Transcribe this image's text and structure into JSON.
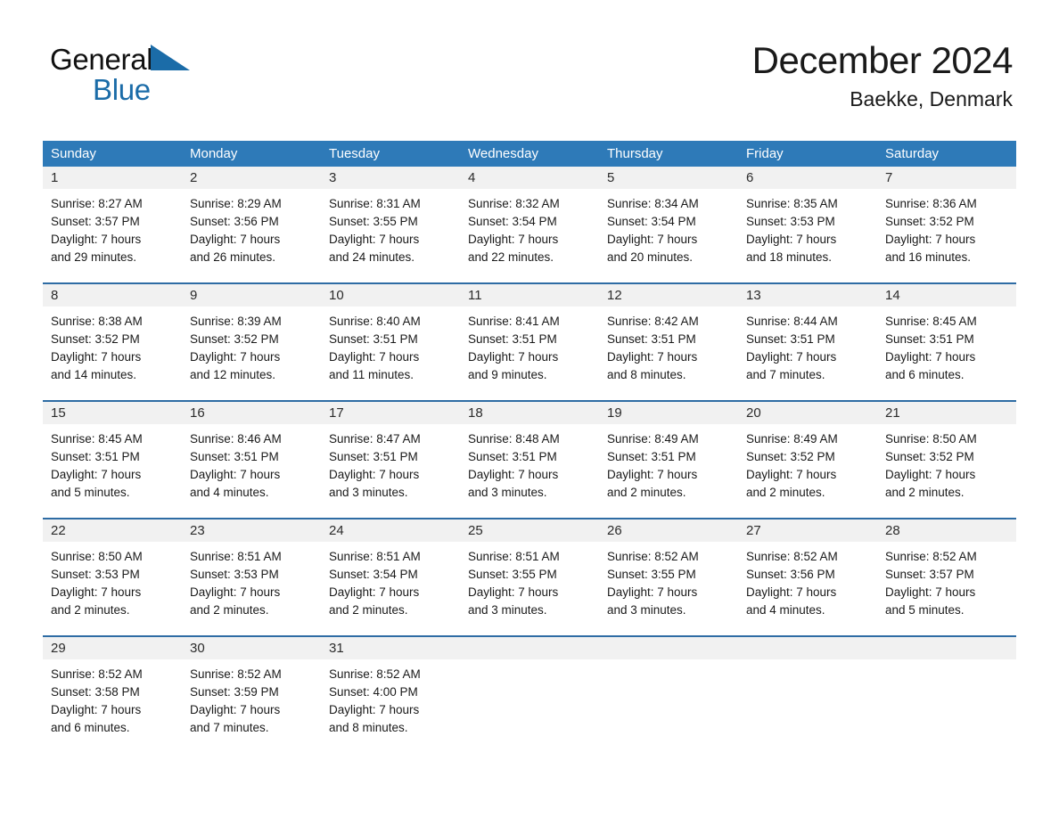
{
  "brand": {
    "name_part1": "General",
    "name_part2": "Blue",
    "triangle_color": "#1b6ca8"
  },
  "header": {
    "month_title": "December 2024",
    "location": "Baekke, Denmark"
  },
  "colors": {
    "header_blue": "#2e7ab8",
    "row_divider_blue": "#2e6ca4",
    "daynum_band_gray": "#f1f1f1",
    "page_background": "#ffffff"
  },
  "weekdays": [
    "Sunday",
    "Monday",
    "Tuesday",
    "Wednesday",
    "Thursday",
    "Friday",
    "Saturday"
  ],
  "weeks": [
    {
      "days": [
        {
          "num": "1",
          "sunrise": "Sunrise: 8:27 AM",
          "sunset": "Sunset: 3:57 PM",
          "daylight1": "Daylight: 7 hours",
          "daylight2": "and 29 minutes."
        },
        {
          "num": "2",
          "sunrise": "Sunrise: 8:29 AM",
          "sunset": "Sunset: 3:56 PM",
          "daylight1": "Daylight: 7 hours",
          "daylight2": "and 26 minutes."
        },
        {
          "num": "3",
          "sunrise": "Sunrise: 8:31 AM",
          "sunset": "Sunset: 3:55 PM",
          "daylight1": "Daylight: 7 hours",
          "daylight2": "and 24 minutes."
        },
        {
          "num": "4",
          "sunrise": "Sunrise: 8:32 AM",
          "sunset": "Sunset: 3:54 PM",
          "daylight1": "Daylight: 7 hours",
          "daylight2": "and 22 minutes."
        },
        {
          "num": "5",
          "sunrise": "Sunrise: 8:34 AM",
          "sunset": "Sunset: 3:54 PM",
          "daylight1": "Daylight: 7 hours",
          "daylight2": "and 20 minutes."
        },
        {
          "num": "6",
          "sunrise": "Sunrise: 8:35 AM",
          "sunset": "Sunset: 3:53 PM",
          "daylight1": "Daylight: 7 hours",
          "daylight2": "and 18 minutes."
        },
        {
          "num": "7",
          "sunrise": "Sunrise: 8:36 AM",
          "sunset": "Sunset: 3:52 PM",
          "daylight1": "Daylight: 7 hours",
          "daylight2": "and 16 minutes."
        }
      ]
    },
    {
      "days": [
        {
          "num": "8",
          "sunrise": "Sunrise: 8:38 AM",
          "sunset": "Sunset: 3:52 PM",
          "daylight1": "Daylight: 7 hours",
          "daylight2": "and 14 minutes."
        },
        {
          "num": "9",
          "sunrise": "Sunrise: 8:39 AM",
          "sunset": "Sunset: 3:52 PM",
          "daylight1": "Daylight: 7 hours",
          "daylight2": "and 12 minutes."
        },
        {
          "num": "10",
          "sunrise": "Sunrise: 8:40 AM",
          "sunset": "Sunset: 3:51 PM",
          "daylight1": "Daylight: 7 hours",
          "daylight2": "and 11 minutes."
        },
        {
          "num": "11",
          "sunrise": "Sunrise: 8:41 AM",
          "sunset": "Sunset: 3:51 PM",
          "daylight1": "Daylight: 7 hours",
          "daylight2": "and 9 minutes."
        },
        {
          "num": "12",
          "sunrise": "Sunrise: 8:42 AM",
          "sunset": "Sunset: 3:51 PM",
          "daylight1": "Daylight: 7 hours",
          "daylight2": "and 8 minutes."
        },
        {
          "num": "13",
          "sunrise": "Sunrise: 8:44 AM",
          "sunset": "Sunset: 3:51 PM",
          "daylight1": "Daylight: 7 hours",
          "daylight2": "and 7 minutes."
        },
        {
          "num": "14",
          "sunrise": "Sunrise: 8:45 AM",
          "sunset": "Sunset: 3:51 PM",
          "daylight1": "Daylight: 7 hours",
          "daylight2": "and 6 minutes."
        }
      ]
    },
    {
      "days": [
        {
          "num": "15",
          "sunrise": "Sunrise: 8:45 AM",
          "sunset": "Sunset: 3:51 PM",
          "daylight1": "Daylight: 7 hours",
          "daylight2": "and 5 minutes."
        },
        {
          "num": "16",
          "sunrise": "Sunrise: 8:46 AM",
          "sunset": "Sunset: 3:51 PM",
          "daylight1": "Daylight: 7 hours",
          "daylight2": "and 4 minutes."
        },
        {
          "num": "17",
          "sunrise": "Sunrise: 8:47 AM",
          "sunset": "Sunset: 3:51 PM",
          "daylight1": "Daylight: 7 hours",
          "daylight2": "and 3 minutes."
        },
        {
          "num": "18",
          "sunrise": "Sunrise: 8:48 AM",
          "sunset": "Sunset: 3:51 PM",
          "daylight1": "Daylight: 7 hours",
          "daylight2": "and 3 minutes."
        },
        {
          "num": "19",
          "sunrise": "Sunrise: 8:49 AM",
          "sunset": "Sunset: 3:51 PM",
          "daylight1": "Daylight: 7 hours",
          "daylight2": "and 2 minutes."
        },
        {
          "num": "20",
          "sunrise": "Sunrise: 8:49 AM",
          "sunset": "Sunset: 3:52 PM",
          "daylight1": "Daylight: 7 hours",
          "daylight2": "and 2 minutes."
        },
        {
          "num": "21",
          "sunrise": "Sunrise: 8:50 AM",
          "sunset": "Sunset: 3:52 PM",
          "daylight1": "Daylight: 7 hours",
          "daylight2": "and 2 minutes."
        }
      ]
    },
    {
      "days": [
        {
          "num": "22",
          "sunrise": "Sunrise: 8:50 AM",
          "sunset": "Sunset: 3:53 PM",
          "daylight1": "Daylight: 7 hours",
          "daylight2": "and 2 minutes."
        },
        {
          "num": "23",
          "sunrise": "Sunrise: 8:51 AM",
          "sunset": "Sunset: 3:53 PM",
          "daylight1": "Daylight: 7 hours",
          "daylight2": "and 2 minutes."
        },
        {
          "num": "24",
          "sunrise": "Sunrise: 8:51 AM",
          "sunset": "Sunset: 3:54 PM",
          "daylight1": "Daylight: 7 hours",
          "daylight2": "and 2 minutes."
        },
        {
          "num": "25",
          "sunrise": "Sunrise: 8:51 AM",
          "sunset": "Sunset: 3:55 PM",
          "daylight1": "Daylight: 7 hours",
          "daylight2": "and 3 minutes."
        },
        {
          "num": "26",
          "sunrise": "Sunrise: 8:52 AM",
          "sunset": "Sunset: 3:55 PM",
          "daylight1": "Daylight: 7 hours",
          "daylight2": "and 3 minutes."
        },
        {
          "num": "27",
          "sunrise": "Sunrise: 8:52 AM",
          "sunset": "Sunset: 3:56 PM",
          "daylight1": "Daylight: 7 hours",
          "daylight2": "and 4 minutes."
        },
        {
          "num": "28",
          "sunrise": "Sunrise: 8:52 AM",
          "sunset": "Sunset: 3:57 PM",
          "daylight1": "Daylight: 7 hours",
          "daylight2": "and 5 minutes."
        }
      ]
    },
    {
      "days": [
        {
          "num": "29",
          "sunrise": "Sunrise: 8:52 AM",
          "sunset": "Sunset: 3:58 PM",
          "daylight1": "Daylight: 7 hours",
          "daylight2": "and 6 minutes."
        },
        {
          "num": "30",
          "sunrise": "Sunrise: 8:52 AM",
          "sunset": "Sunset: 3:59 PM",
          "daylight1": "Daylight: 7 hours",
          "daylight2": "and 7 minutes."
        },
        {
          "num": "31",
          "sunrise": "Sunrise: 8:52 AM",
          "sunset": "Sunset: 4:00 PM",
          "daylight1": "Daylight: 7 hours",
          "daylight2": "and 8 minutes."
        },
        {
          "num": "",
          "sunrise": "",
          "sunset": "",
          "daylight1": "",
          "daylight2": ""
        },
        {
          "num": "",
          "sunrise": "",
          "sunset": "",
          "daylight1": "",
          "daylight2": ""
        },
        {
          "num": "",
          "sunrise": "",
          "sunset": "",
          "daylight1": "",
          "daylight2": ""
        },
        {
          "num": "",
          "sunrise": "",
          "sunset": "",
          "daylight1": "",
          "daylight2": ""
        }
      ]
    }
  ]
}
